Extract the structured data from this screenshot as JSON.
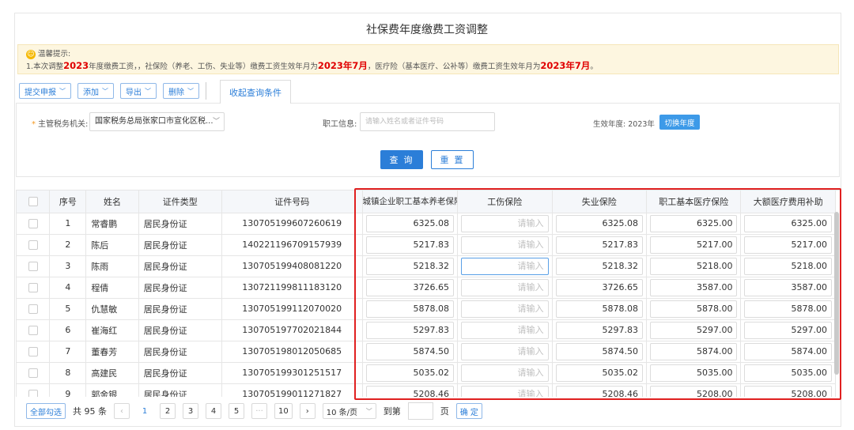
{
  "page": {
    "title": "社保费年度缴费工资调整"
  },
  "notice": {
    "icon": "smile-icon",
    "heading": "温馨提示:",
    "line": [
      "1.本次调整",
      "2023",
      "年度缴费工资，，社保险（养老、工伤、失业等）缴费工资生效年月为",
      "2023年7月",
      "，医疗险（基本医疗、公补等）缴费工资生效年月为",
      "2023年7月",
      "。"
    ]
  },
  "toolbar": {
    "buttons": [
      "提交申报",
      "添加",
      "导出",
      "删除"
    ],
    "collapse_tab": "收起查询条件"
  },
  "filter": {
    "tax_office_label": "主管税务机关:",
    "tax_office_value": "国家税务总局张家口市宣化区税...",
    "employee_label": "职工信息:",
    "employee_placeholder": "请输入姓名或者证件号码",
    "year_label": "生效年度:",
    "year_value": "2023年",
    "switch_year": "切换年度",
    "query": "查 询",
    "reset": "重 置"
  },
  "table": {
    "columns": [
      "序号",
      "姓名",
      "证件类型",
      "证件号码",
      "城镇企业职工基本养老保险",
      "工伤保险",
      "失业保险",
      "职工基本医疗保险",
      "大额医疗费用补助"
    ],
    "input_placeholder": "请输入",
    "rows": [
      [
        "1",
        "常睿鹏",
        "居民身份证",
        "130705199607260619",
        "6325.08",
        "",
        "6325.08",
        "6325.00",
        "6325.00"
      ],
      [
        "2",
        "陈后",
        "居民身份证",
        "140221196709157939",
        "5217.83",
        "",
        "5217.83",
        "5217.00",
        "5217.00"
      ],
      [
        "3",
        "陈雨",
        "居民身份证",
        "130705199408081220",
        "5218.32",
        "",
        "5218.32",
        "5218.00",
        "5218.00"
      ],
      [
        "4",
        "程倩",
        "居民身份证",
        "130721199811183120",
        "3726.65",
        "",
        "3726.65",
        "3587.00",
        "3587.00"
      ],
      [
        "5",
        "仇慧敏",
        "居民身份证",
        "130705199112070020",
        "5878.08",
        "",
        "5878.08",
        "5878.00",
        "5878.00"
      ],
      [
        "6",
        "崔海红",
        "居民身份证",
        "130705197702021844",
        "5297.83",
        "",
        "5297.83",
        "5297.00",
        "5297.00"
      ],
      [
        "7",
        "董春芳",
        "居民身份证",
        "130705198012050685",
        "5874.50",
        "",
        "5874.50",
        "5874.00",
        "5874.00"
      ],
      [
        "8",
        "高建民",
        "居民身份证",
        "130705199301251517",
        "5035.02",
        "",
        "5035.02",
        "5035.00",
        "5035.00"
      ],
      [
        "9",
        "郭金银",
        "居民身份证",
        "130705199011271827",
        "5208.46",
        "",
        "5208.46",
        "5208.00",
        "5208.00"
      ]
    ]
  },
  "pager": {
    "select_all": "全部勾选",
    "total": "共 95 条",
    "pages": [
      "1",
      "2",
      "3",
      "4",
      "5",
      "···",
      "10"
    ],
    "page_size": "10 条/页",
    "goto": "到第",
    "page_unit": "页",
    "confirm": "确 定"
  }
}
